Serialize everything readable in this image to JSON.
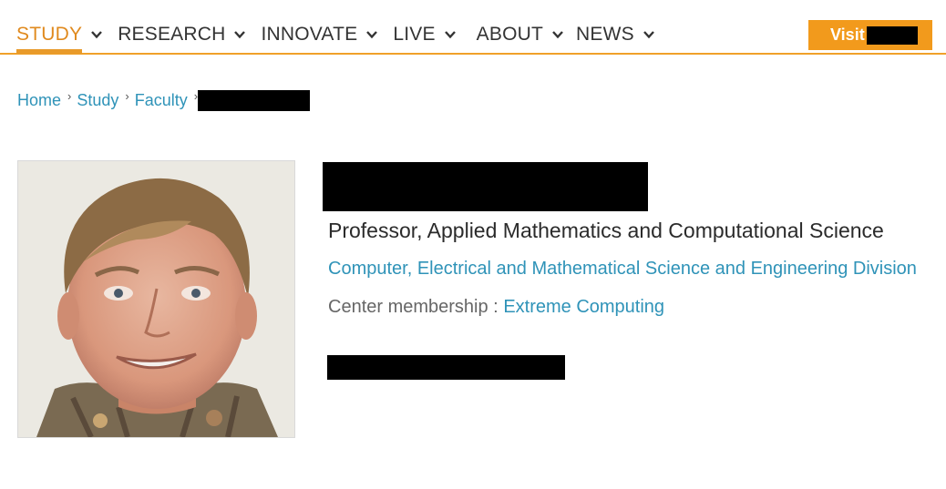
{
  "nav": {
    "items": [
      {
        "label": "STUDY",
        "active": true
      },
      {
        "label": "RESEARCH",
        "active": false
      },
      {
        "label": "INNOVATE",
        "active": false
      },
      {
        "label": "LIVE",
        "active": false
      },
      {
        "label": "ABOUT",
        "active": false
      },
      {
        "label": "NEWS",
        "active": false
      }
    ],
    "visit_label": "Visit"
  },
  "breadcrumb": {
    "items": [
      "Home",
      "Study",
      "Faculty"
    ]
  },
  "profile": {
    "title": "Professor, Applied Mathematics and Computational Science",
    "division": "Computer, Electrical and Mathematical Science and Engineering Division",
    "center_label": "Center membership :",
    "center_link": "Extreme Computing"
  },
  "colors": {
    "accent": "#f29a1c",
    "link": "#2f93b8",
    "active_nav": "#e08a1e"
  }
}
